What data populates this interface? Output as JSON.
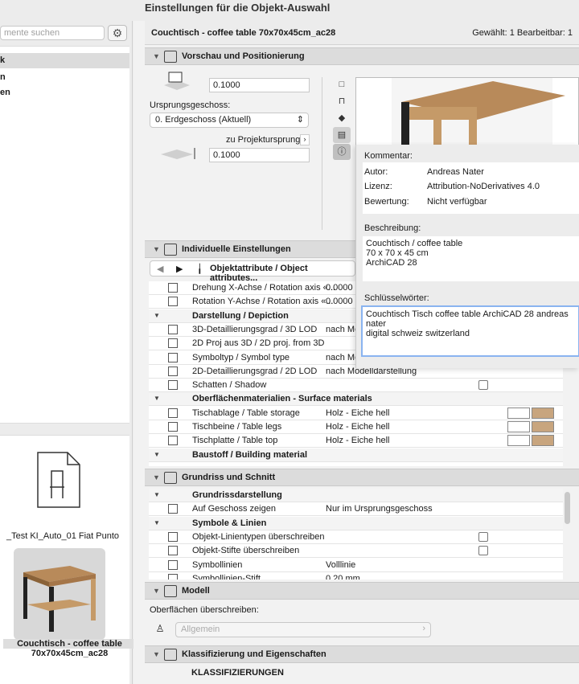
{
  "window_title": "Einstellungen für die Objekt-Auswahl",
  "left": {
    "search_placeholder": "mente suchen",
    "tree_items": [
      "k",
      "n",
      "en"
    ],
    "library_item_label": "_Test KI_Auto_01 Fiat Punto",
    "selected_item_label_1": "Couchtisch - coffee table",
    "selected_item_label_2": "70x70x45cm_ac28"
  },
  "header": {
    "object_name": "Couchtisch - coffee table 70x70x45cm_ac28",
    "selection_info": "Gewählt: 1 Bearbeitbar: 1"
  },
  "sections": {
    "preview": "Vorschau und Positionierung",
    "individual": "Individuelle Einstellungen",
    "floorplan": "Grundriss und Schnitt",
    "model": "Modell",
    "classification": "Klassifizierung und Eigenschaften"
  },
  "positioning": {
    "elevation_value": "0.1000",
    "home_story_label": "Ursprungsgeschoss:",
    "home_story_value": "0. Erdgeschoss (Aktuell)",
    "to_project_origin_label": "zu Projektursprung",
    "project_origin_value": "0.1000"
  },
  "popup": {
    "comment_label": "Kommentar:",
    "author_label": "Autor:",
    "author_value": "Andreas Nater",
    "license_label": "Lizenz:",
    "license_value": "Attribution-NoDerivatives 4.0",
    "rating_label": "Bewertung:",
    "rating_value": "Nicht verfügbar",
    "description_label": "Beschreibung:",
    "description_lines": [
      "Couchtisch / coffee table",
      "70 x 70 x 45 cm",
      "ArchiCAD 28"
    ],
    "keywords_label": "Schlüsselwörter:",
    "keywords_lines": [
      "Couchtisch Tisch coffee table ArchiCAD 28 andreas nater",
      "digital schweiz switzerland"
    ]
  },
  "individual": {
    "page_name": "Objektattribute / Object attributes...",
    "rows": [
      {
        "label": "Drehung X-Achse / Rotation axis «...",
        "value": "0.0000",
        "type": "param"
      },
      {
        "label": "Rotation Y-Achse / Rotation axis «...",
        "value": "0.0000",
        "type": "param"
      },
      {
        "label": "Darstellung /  Depiction",
        "value": "",
        "type": "group"
      },
      {
        "label": "3D-Detaillierungsgrad / 3D LOD",
        "value": "nach Mo",
        "type": "param"
      },
      {
        "label": "2D Proj aus 3D / 2D proj. from 3D",
        "value": "",
        "type": "param"
      },
      {
        "label": "Symboltyp / Symbol type",
        "value": "nach Mo",
        "type": "param"
      },
      {
        "label": "2D-Detaillierungsgrad / 2D LOD",
        "value": "nach Modelldarstellung",
        "type": "param"
      },
      {
        "label": "Schatten / Shadow",
        "value": "",
        "type": "check"
      },
      {
        "label": "Oberflächenmaterialien - Surface materials",
        "value": "",
        "type": "group"
      },
      {
        "label": "Tischablage / Table storage",
        "value": "Holz - Eiche hell",
        "type": "material"
      },
      {
        "label": "Tischbeine / Table legs",
        "value": "Holz - Eiche hell",
        "type": "material"
      },
      {
        "label": "Tischplatte / Table top",
        "value": "Holz - Eiche hell",
        "type": "material"
      },
      {
        "label": "Baustoff / Building material",
        "value": "",
        "type": "group"
      }
    ]
  },
  "floorplan": {
    "rows": [
      {
        "label": "Grundrissdarstellung",
        "value": "",
        "type": "group"
      },
      {
        "label": "Auf Geschoss zeigen",
        "value": "Nur im Ursprungsgeschoss",
        "type": "param"
      },
      {
        "label": "Symbole & Linien",
        "value": "",
        "type": "group"
      },
      {
        "label": "Objekt-Linientypen überschreiben",
        "value": "",
        "type": "check"
      },
      {
        "label": "Objekt-Stifte überschreiben",
        "value": "",
        "type": "check"
      },
      {
        "label": "Symbollinien",
        "value": "Volllinie",
        "type": "param"
      },
      {
        "label": "Symbollinien-Stift",
        "value": "0.20 mm",
        "type": "param"
      }
    ]
  },
  "model": {
    "override_label": "Oberflächen überschreiben:",
    "surface_value": "Allgemein"
  },
  "classification": {
    "heading": "KLASSIFIZIERUNGEN"
  },
  "colors": {
    "wood": "#c8a57e",
    "accent": "#3b82f6",
    "pen_green": "#2ca02c"
  }
}
